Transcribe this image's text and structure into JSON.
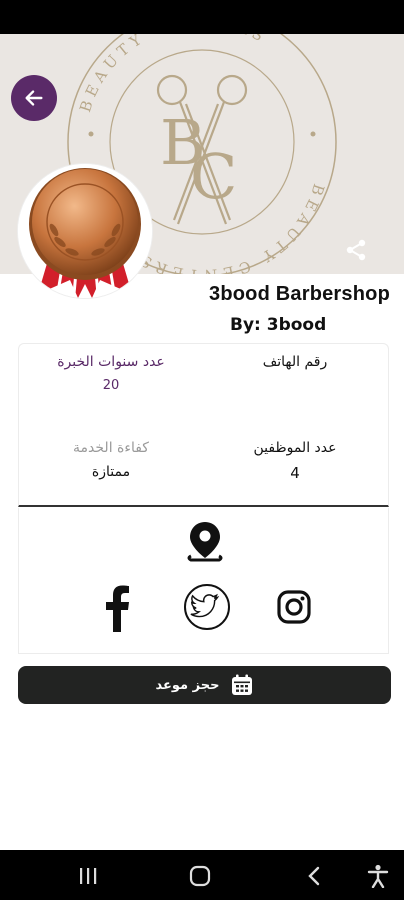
{
  "cover": {
    "brand_text_top": "BEAUTY CENTERS",
    "brand_text_bottom": "BEAUTY CENTERS",
    "monogram": "BC",
    "background_color": "#eae6e2",
    "line_color": "#b8a88a"
  },
  "header": {
    "back_icon": "arrow-left-icon",
    "share_icon": "share-icon"
  },
  "shop": {
    "name": "3bood Barbershop",
    "owner": "By: 3bood"
  },
  "info": {
    "phone_label": "رقم الهاتف",
    "phone_value": "",
    "experience_label": "عدد سنوات الخبرة",
    "experience_value": "20",
    "employees_label": "عدد الموظفين",
    "employees_value": "4",
    "efficiency_label": "كفاءة الخدمة",
    "efficiency_value": "ممتازة"
  },
  "social": {
    "location_icon": "map-pin-icon",
    "facebook_icon": "facebook-icon",
    "twitter_icon": "twitter-icon",
    "instagram_icon": "instagram-icon"
  },
  "booking": {
    "label": "حجز موعد",
    "icon": "calendar-icon"
  },
  "colors": {
    "accent": "#5a2a68",
    "button_dark": "#222322",
    "experience_label": "#5a2a68",
    "efficiency_label": "#9a9a9a"
  }
}
